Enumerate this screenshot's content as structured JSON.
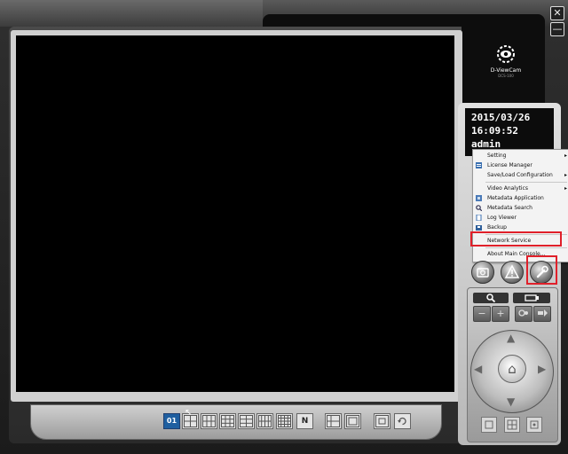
{
  "window": {
    "close_glyph": "✕",
    "minimize_glyph": "—"
  },
  "logo": {
    "name": "D-ViewCam",
    "version": "DCS-100"
  },
  "status": {
    "date": "2015/03/26",
    "time": "16:09:52",
    "user": "admin"
  },
  "menu": {
    "items": [
      {
        "label": "Setting",
        "submenu": true,
        "icon": "none"
      },
      {
        "label": "License Manager",
        "submenu": false,
        "icon": "license-icon"
      },
      {
        "label": "Save/Load Configuration",
        "submenu": true,
        "icon": "none"
      },
      {
        "label": "Video Analytics",
        "submenu": true,
        "icon": "none"
      },
      {
        "label": "Metadata Application",
        "submenu": false,
        "icon": "metadata-app-icon"
      },
      {
        "label": "Metadata Search",
        "submenu": false,
        "icon": "search-icon"
      },
      {
        "label": "Log Viewer",
        "submenu": false,
        "icon": "log-icon"
      },
      {
        "label": "Backup",
        "submenu": false,
        "icon": "backup-icon"
      },
      {
        "label": "Network Service",
        "submenu": false,
        "icon": "none"
      },
      {
        "label": "About Main Console...",
        "submenu": false,
        "icon": "none"
      }
    ],
    "submenu_arrow": "▸"
  },
  "highlight_color": "#e0202a",
  "accent_color": "#1f5fa0",
  "layouts": {
    "single_label": "01",
    "n_label": "N"
  },
  "ptz": {
    "zoom_out": "−",
    "zoom_in": "+",
    "home_glyph": "⌂"
  }
}
